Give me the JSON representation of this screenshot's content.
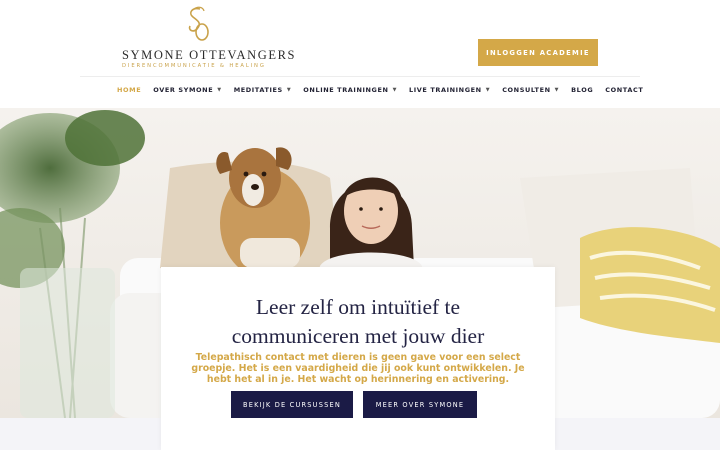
{
  "header": {
    "logo_name": "SYMONE OTTEVANGERS",
    "logo_tagline": "DIERENCOMMUNICATIE & HEALING",
    "login_button": "INLOGGEN ACADEMIE"
  },
  "nav": {
    "items": [
      {
        "label": "HOME",
        "active": true,
        "dropdown": false
      },
      {
        "label": "OVER SYMONE",
        "dropdown": true
      },
      {
        "label": "MEDITATIES",
        "dropdown": true
      },
      {
        "label": "ONLINE TRAININGEN",
        "dropdown": true
      },
      {
        "label": "LIVE TRAININGEN",
        "dropdown": true
      },
      {
        "label": "CONSULTEN",
        "dropdown": true
      },
      {
        "label": "BLOG",
        "dropdown": false
      },
      {
        "label": "CONTACT",
        "dropdown": false
      }
    ]
  },
  "hero": {
    "title_line1": "Leer zelf om intuïtief te",
    "title_line2": "communiceren met jouw dier",
    "text_line1": "Telepathisch contact met dieren is geen gave voor een select",
    "text_line2": "groepje. Het is een vaardigheid die jij ook kunt ontwikkelen. Je",
    "text_line3": "hebt het al in je. Het wacht op herinnering en activering.",
    "button_courses": "BEKIJK DE CURSUSSEN",
    "button_about": "MEER OVER SYMONE"
  },
  "colors": {
    "gold": "#d4a848",
    "navy": "#1b1b46",
    "title": "#242444"
  },
  "icons": {
    "logo": "so-monogram-icon",
    "dropdown": "chevron-down-icon"
  }
}
